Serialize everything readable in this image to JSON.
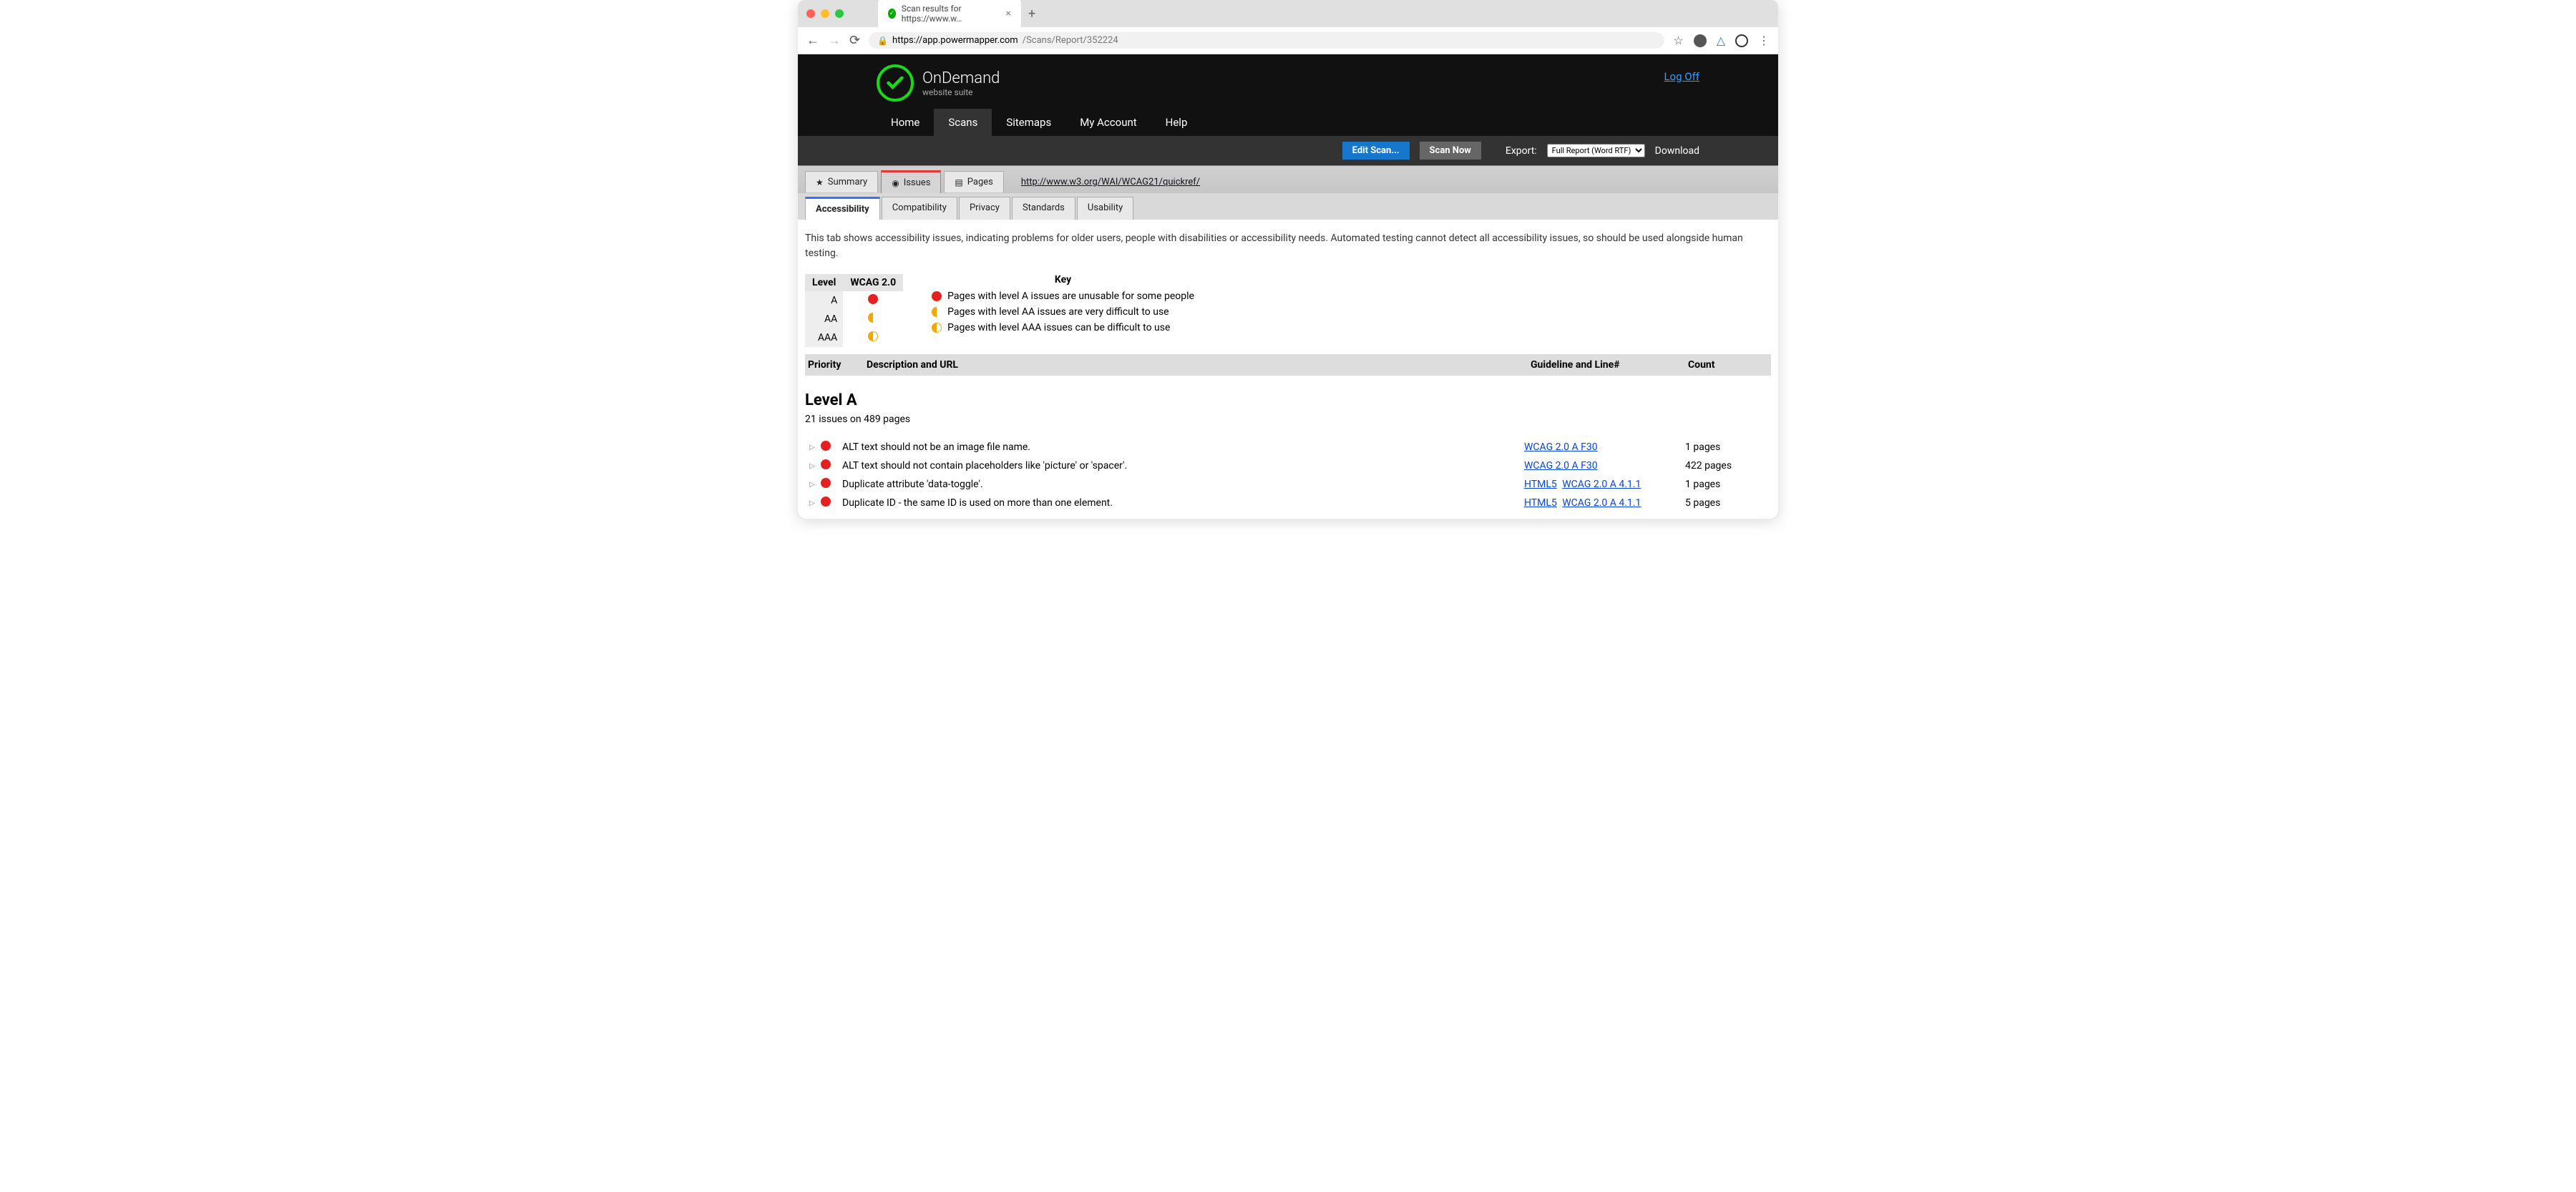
{
  "browser": {
    "tab_title": "Scan results for https://www.w…",
    "url_host": "https://app.powermapper.com",
    "url_path": "/Scans/Report/352224"
  },
  "brand": {
    "title": "OnDemand",
    "sub": "website suite"
  },
  "logoff": "Log Off",
  "nav": [
    "Home",
    "Scans",
    "Sitemaps",
    "My Account",
    "Help"
  ],
  "nav_active": 1,
  "toolbar": {
    "edit": "Edit Scan...",
    "scan": "Scan Now",
    "export_label": "Export:",
    "export_option": "Full Report (Word RTF)",
    "download": "Download"
  },
  "primary_tabs": [
    "Summary",
    "Issues",
    "Pages"
  ],
  "primary_active": 1,
  "reflink": "http://www.w3.org/WAI/WCAG21/quickref/",
  "secondary_tabs": [
    "Accessibility",
    "Compatibility",
    "Privacy",
    "Standards",
    "Usability"
  ],
  "secondary_active": 0,
  "intro": "This tab shows accessibility issues, indicating problems for older users, people with disabilities or accessibility needs. Automated testing cannot detect all accessibility issues, so should be used alongside human testing.",
  "level_header": {
    "level": "Level",
    "wcag": "WCAG 2.0"
  },
  "levels": [
    "A",
    "AA",
    "AAA"
  ],
  "key_header": "Key",
  "key": [
    "Pages with level A issues are unusable for some people",
    "Pages with level AA issues are very difficult to use",
    "Pages with level AAA issues can be difficult to use"
  ],
  "grid_headers": {
    "priority": "Priority",
    "desc": "Description and URL",
    "guideline": "Guideline and Line#",
    "count": "Count"
  },
  "section": {
    "head": "Level A",
    "sub": "21 issues on 489 pages"
  },
  "issues": [
    {
      "desc": "ALT text should not be an image file name.",
      "guides": [
        "WCAG 2.0 A F30"
      ],
      "count": "1 pages"
    },
    {
      "desc": "ALT text should not contain placeholders like 'picture' or 'spacer'.",
      "guides": [
        "WCAG 2.0 A F30"
      ],
      "count": "422 pages"
    },
    {
      "desc": "Duplicate attribute 'data-toggle'.",
      "guides": [
        "HTML5",
        "WCAG 2.0 A 4.1.1"
      ],
      "count": "1 pages"
    },
    {
      "desc": "Duplicate ID - the same ID is used on more than one element.",
      "guides": [
        "HTML5",
        "WCAG 2.0 A 4.1.1"
      ],
      "count": "5 pages"
    }
  ]
}
